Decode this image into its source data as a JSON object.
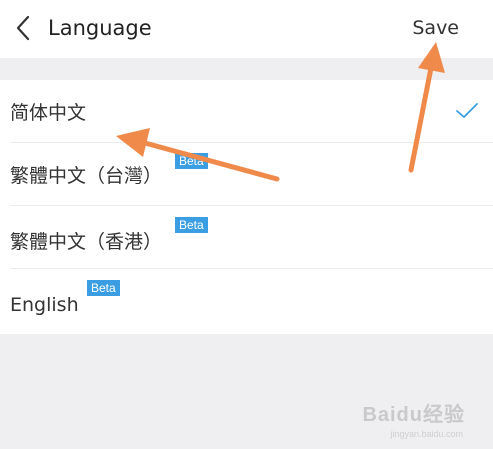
{
  "header": {
    "title": "Language",
    "save_label": "Save"
  },
  "languages": [
    {
      "label": "简体中文",
      "badge": "",
      "selected": true
    },
    {
      "label": "繁體中文（台灣）",
      "badge": "Beta",
      "selected": false
    },
    {
      "label": "繁體中文（香港）",
      "badge": "Beta",
      "selected": false
    },
    {
      "label": "English",
      "badge": "Beta",
      "selected": false
    }
  ],
  "watermark": {
    "brand": "Baidu经验",
    "url": "jingyan.baidu.com"
  },
  "colors": {
    "accent": "#3b9ee2",
    "arrow": "#f08a4b",
    "background": "#efeff1"
  },
  "icons": {
    "back": "chevron-left-icon",
    "selected": "checkmark-icon"
  }
}
